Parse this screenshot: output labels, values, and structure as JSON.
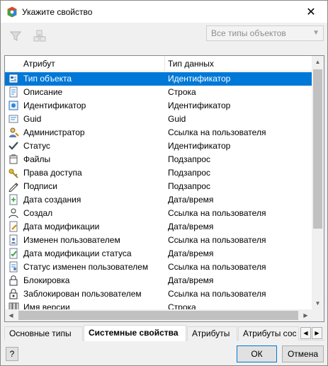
{
  "window": {
    "title": "Укажите свойство"
  },
  "toolbar": {
    "type_select": "Все типы объектов"
  },
  "list": {
    "columns": [
      "Атрибут",
      "Тип данных"
    ],
    "rows": [
      {
        "name": "Тип объекта",
        "type": "Идентификатор",
        "icon": "object-type-icon",
        "selected": true
      },
      {
        "name": "Описание",
        "type": "Строка",
        "icon": "description-icon"
      },
      {
        "name": "Идентификатор",
        "type": "Идентификатор",
        "icon": "identifier-icon"
      },
      {
        "name": "Guid",
        "type": "Guid",
        "icon": "guid-icon"
      },
      {
        "name": "Администратор",
        "type": "Ссылка на пользователя",
        "icon": "admin-user-icon"
      },
      {
        "name": "Статус",
        "type": "Идентификатор",
        "icon": "checkmark-icon"
      },
      {
        "name": "Файлы",
        "type": "Подзапрос",
        "icon": "files-icon"
      },
      {
        "name": "Права доступа",
        "type": "Подзапрос",
        "icon": "keys-icon"
      },
      {
        "name": "Подписи",
        "type": "Подзапрос",
        "icon": "pen-icon"
      },
      {
        "name": "Дата создания",
        "type": "Дата/время",
        "icon": "document-plus-icon"
      },
      {
        "name": "Создал",
        "type": "Ссылка на пользователя",
        "icon": "user-icon"
      },
      {
        "name": "Дата модификации",
        "type": "Дата/время",
        "icon": "document-edit-icon"
      },
      {
        "name": "Изменен пользователем",
        "type": "Ссылка на пользователя",
        "icon": "user-edit-icon"
      },
      {
        "name": "Дата модификации статуса",
        "type": "Дата/время",
        "icon": "document-check-icon"
      },
      {
        "name": "Статус изменен пользователем",
        "type": "Ссылка на пользователя",
        "icon": "status-user-icon"
      },
      {
        "name": "Блокировка",
        "type": "Дата/время",
        "icon": "lock-icon"
      },
      {
        "name": "Заблокирован пользователем",
        "type": "Ссылка на пользователя",
        "icon": "lock-user-icon"
      },
      {
        "name": "Имя версии",
        "type": "Строка",
        "icon": "version-icon"
      }
    ]
  },
  "tabs": [
    "Основные типы",
    "Системные свойства",
    "Атрибуты",
    "Атрибуты сос"
  ],
  "active_tab": 1,
  "footer": {
    "help": "?",
    "ok": "ОК",
    "cancel": "Отмена"
  },
  "colors": {
    "selection": "#0078d7",
    "window_bg": "#f0f0f0"
  }
}
